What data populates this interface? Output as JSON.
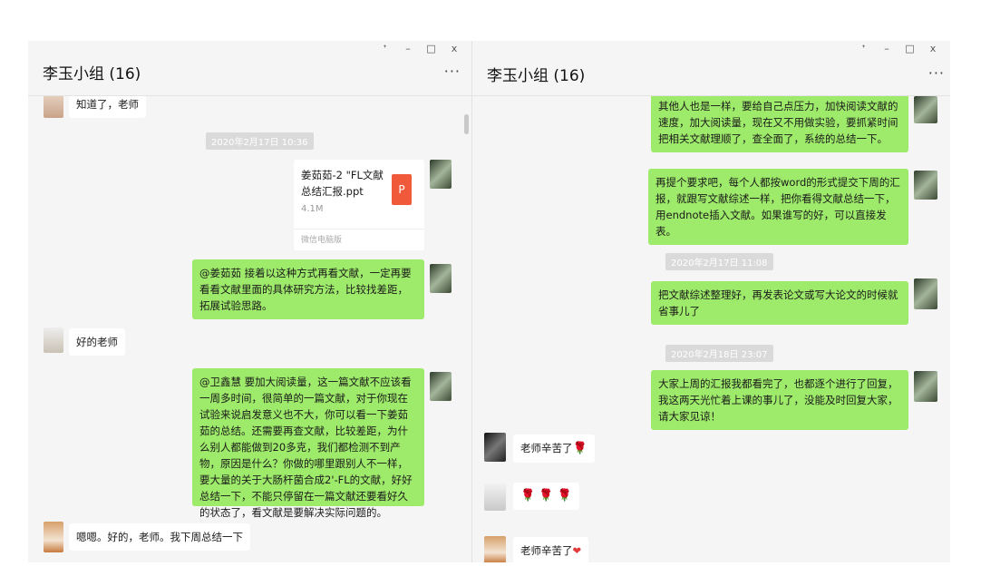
{
  "left": {
    "title": "李玉小组 (16)",
    "controls": {
      "pin": "ᐩ",
      "min": "–",
      "max": "□",
      "close": "x"
    },
    "more": "···",
    "messages": {
      "m1": "知道了，老师",
      "ts1": "2020年2月17日 10:36",
      "file_name": "姜茹茹-2 \"FL文献总结汇报.ppt",
      "file_size": "4.1M",
      "file_source": "微信电脑版",
      "file_icon_letter": "P",
      "m2": "@姜茹茹 接着以这种方式再看文献，一定再要看看文献里面的具体研究方法，比较找差距，拓展试验思路。",
      "m3": "好的老师",
      "m4": "@卫鑫慧 要加大阅读量，这一篇文献不应该看一周多时间，很简单的一篇文献，对于你现在试验来说启发意义也不大，你可以看一下姜茹茹的总结。还需要再查文献，比较差距，为什么别人都能做到20多克，我们都检测不到产物，原因是什么？你做的哪里跟别人不一样，要大量的关于大肠杆菌合成2'-FL的文献，好好总结一下，不能只停留在一篇文献还要看好久的状态了，看文献是要解决实际问题的。",
      "m5": "嗯嗯。好的，老师。我下周总结一下"
    }
  },
  "right": {
    "title": "李玉小组 (16)",
    "controls": {
      "pin": "ᐩ",
      "min": "–",
      "max": "□",
      "close": "x"
    },
    "more": "···",
    "messages": {
      "r1": "其他人也是一样，要给自己点压力，加快阅读文献的速度，加大阅读量，现在又不用做实验，要抓紧时间把相关文献理顺了，查全面了，系统的总结一下。",
      "r2": "再提个要求吧，每个人都按word的形式提交下周的汇报，就跟写文献综述一样，把你看得文献总结一下，用endnote插入文献。如果谁写的好，可以直接发表。",
      "ts2": "2020年2月17日 11:08",
      "r3": "把文献综述整理好，再发表论文或写大论文的时候就省事儿了",
      "ts3": "2020年2月18日 23:07",
      "r4": "大家上周的汇报我都看完了，也都逐个进行了回复，我这两天光忙着上课的事儿了，没能及时回复大家，请大家见谅！",
      "r5": "老师辛苦了",
      "r6": "🌹 🌹 🌹",
      "r7": "老师辛苦了"
    }
  },
  "colors": {
    "green_bubble": "#9eea6a",
    "bg": "#f5f5f5",
    "file_icon": "#f05a3a"
  }
}
